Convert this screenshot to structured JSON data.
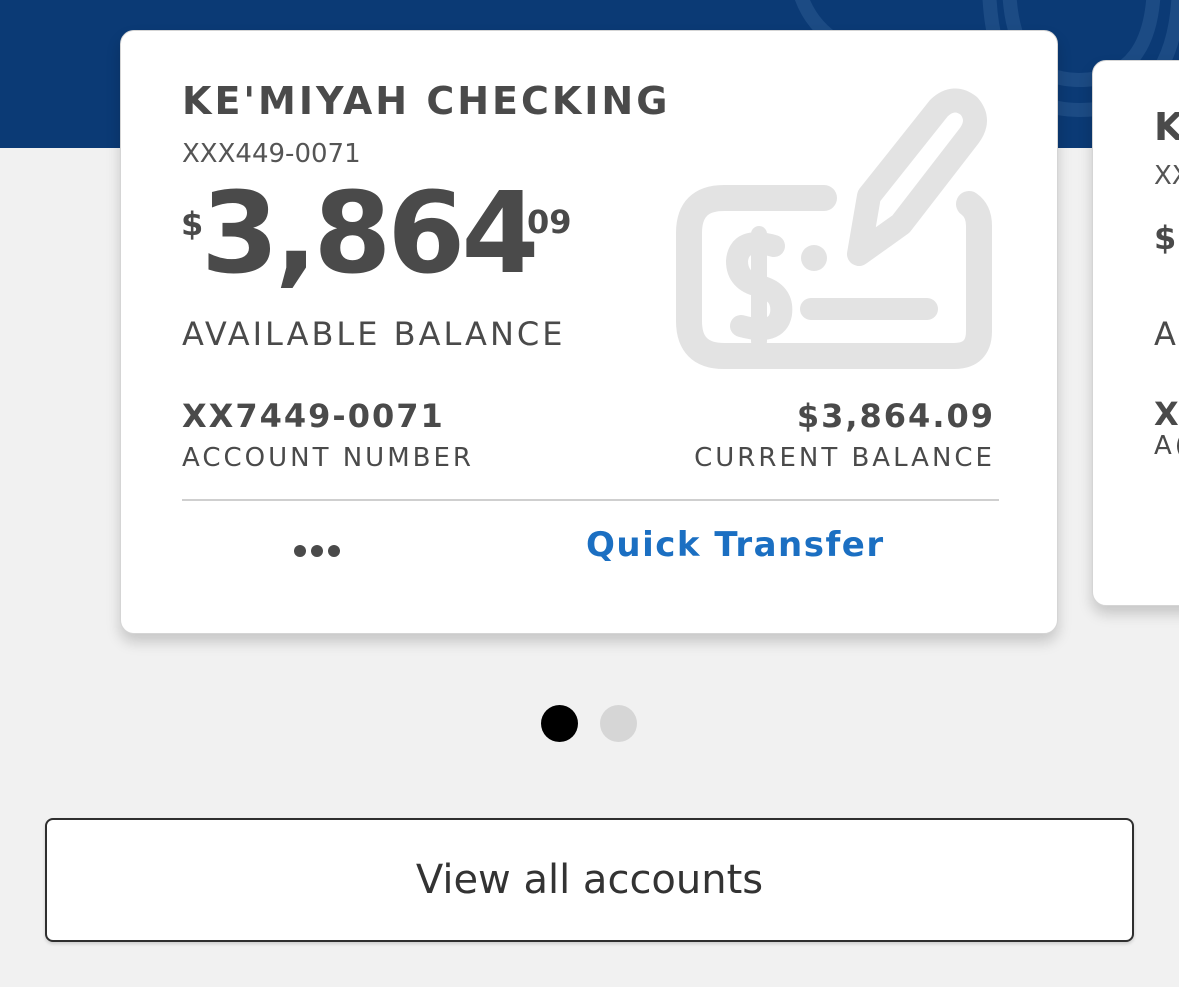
{
  "colors": {
    "header_background": "#0b3a75",
    "page_background": "#f1f1f1",
    "card_background": "#ffffff",
    "text_primary": "#4a4a4a",
    "link": "#1b6fc2",
    "icon_gray": "#e3e3e3",
    "pager_active": "#000000",
    "pager_inactive": "#d6d6d6"
  },
  "accounts": [
    {
      "title": "KE'MIYAH CHECKING",
      "masked_number": "XXX449-0071",
      "available_balance": {
        "currency_symbol": "$",
        "dollars": "3,864",
        "cents": "09",
        "label": "AVAILABLE BALANCE"
      },
      "account_number": "XX7449-0071",
      "account_number_label": "ACCOUNT NUMBER",
      "current_balance": "$3,864.09",
      "current_balance_label": "CURRENT BALANCE",
      "icon": "check-with-dollar-and-pen-icon",
      "more_label": "•••",
      "quick_transfer_label": "Quick Transfer"
    },
    {
      "title_visible": "K",
      "masked_number_visible": "XX",
      "balance_visible": "$",
      "balance_label_visible": "A",
      "account_number_visible": "X",
      "account_number_label_visible": "A("
    }
  ],
  "pager": {
    "count": 2,
    "active_index": 0
  },
  "view_all_label": "View all accounts"
}
